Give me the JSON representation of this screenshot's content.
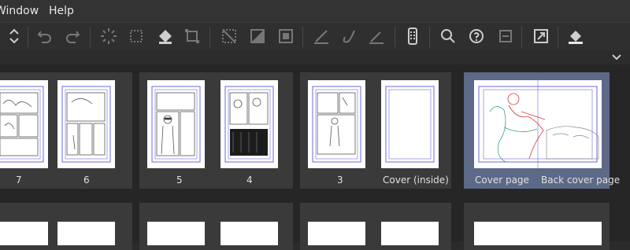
{
  "menu": {
    "window": "Window",
    "help": "Help"
  },
  "toolbar": {
    "icons": [
      "updown-icon",
      "undo-icon",
      "redo-icon",
      "loading-icon",
      "crop-icon",
      "fill-icon",
      "transform-icon",
      "clear-selection-icon",
      "invert-selection-icon",
      "show-selection-icon",
      "pen-icon",
      "brush-icon",
      "line-icon",
      "device-icon",
      "zoom-icon",
      "help-icon",
      "export-icon",
      "fullscreen-icon",
      "fill-color-icon"
    ]
  },
  "pages": [
    {
      "label": "7"
    },
    {
      "label": "6"
    },
    {
      "label": "5"
    },
    {
      "label": "4"
    },
    {
      "label": "3"
    },
    {
      "label": "Cover (inside)"
    },
    {
      "label": "Cover page"
    },
    {
      "label": "Back cover page"
    }
  ],
  "colors": {
    "selected": "#5c6a88",
    "guide": "#4a4ad0"
  }
}
